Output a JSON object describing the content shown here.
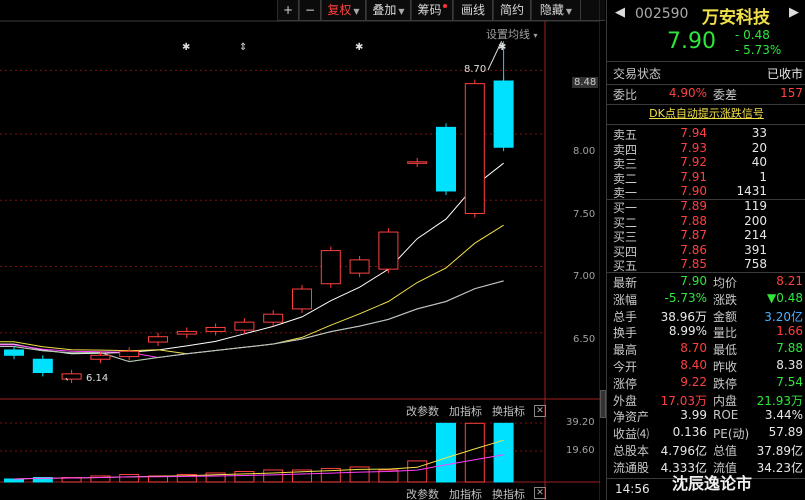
{
  "toolbar": [
    {
      "label": "+",
      "w": 22
    },
    {
      "label": "−",
      "w": 22
    },
    {
      "label": "复权",
      "w": 45,
      "active": true,
      "arrow": true
    },
    {
      "label": "叠加",
      "w": 45,
      "arrow": true
    },
    {
      "label": "筹码",
      "w": 42,
      "dot": true
    },
    {
      "label": "画线",
      "w": 40
    },
    {
      "label": "简约",
      "w": 38
    },
    {
      "label": "隐藏",
      "w": 50,
      "arrow": true
    }
  ],
  "chart": {
    "ma_setting": "设置均线",
    "max_label": "8.70",
    "min_label": "6.14",
    "price_ticks": [
      "8.48",
      "8.00",
      "7.50",
      "7.00",
      "6.50"
    ],
    "volume_ticks": [
      "39.20",
      "19.60"
    ],
    "indicator_buttons_top": [
      "改参数",
      "加指标",
      "换指标"
    ],
    "indicator_buttons_bottom": [
      "改参数",
      "加指标",
      "换指标"
    ],
    "star": "✱",
    "updown": "⇕",
    "close": "✕"
  },
  "chart_data": {
    "type": "candlestick",
    "ylim": [
      6.0,
      8.8
    ],
    "candles": [
      {
        "o": 6.37,
        "c": 6.33
      },
      {
        "o": 6.3,
        "c": 6.2
      },
      {
        "o": 6.15,
        "c": 6.19
      },
      {
        "o": 6.3,
        "c": 6.33
      },
      {
        "o": 6.32,
        "c": 6.36
      },
      {
        "o": 6.43,
        "c": 6.47
      },
      {
        "o": 6.49,
        "c": 6.51
      },
      {
        "o": 6.51,
        "c": 6.54
      },
      {
        "o": 6.52,
        "c": 6.58
      },
      {
        "o": 6.58,
        "c": 6.64
      },
      {
        "o": 6.68,
        "c": 6.83
      },
      {
        "o": 6.87,
        "c": 7.12
      },
      {
        "o": 6.95,
        "c": 7.05
      },
      {
        "o": 6.98,
        "c": 7.26
      },
      {
        "o": 7.78,
        "c": 7.79
      },
      {
        "o": 8.05,
        "c": 7.57
      },
      {
        "o": 7.4,
        "c": 8.38
      },
      {
        "o": 8.4,
        "c": 7.9
      }
    ],
    "volumes": [
      2,
      3,
      3,
      4,
      5,
      4,
      5,
      6,
      7,
      8,
      8,
      9,
      10,
      8,
      14,
      39,
      39,
      39
    ]
  },
  "quote": {
    "code": "002590",
    "name": "万安科技",
    "price": "7.90",
    "change": "- 0.48",
    "change_pct": "- 5.73%",
    "status_label": "交易状态",
    "status_value": "已收市",
    "wb_label": "委比",
    "wb_value": "4.90%",
    "wc_label": "委差",
    "wc_value": "157",
    "dk_signal": "DK点自动提示涨跌信号",
    "sell": [
      {
        "label": "卖五",
        "price": "7.94",
        "vol": "33"
      },
      {
        "label": "卖四",
        "price": "7.93",
        "vol": "20"
      },
      {
        "label": "卖三",
        "price": "7.92",
        "vol": "40"
      },
      {
        "label": "卖二",
        "price": "7.91",
        "vol": "1"
      },
      {
        "label": "卖一",
        "price": "7.90",
        "vol": "1431"
      }
    ],
    "buy": [
      {
        "label": "买一",
        "price": "7.89",
        "vol": "119"
      },
      {
        "label": "买二",
        "price": "7.88",
        "vol": "200"
      },
      {
        "label": "买三",
        "price": "7.87",
        "vol": "214"
      },
      {
        "label": "买四",
        "price": "7.86",
        "vol": "391"
      },
      {
        "label": "买五",
        "price": "7.85",
        "vol": "758"
      }
    ],
    "stats": [
      {
        "l1": "最新",
        "v1": "7.90",
        "c1": "green",
        "l2": "均价",
        "v2": "8.21",
        "c2": "red"
      },
      {
        "l1": "涨幅",
        "v1": "-5.73%",
        "c1": "green",
        "l2": "涨跌",
        "v2": "▼0.48",
        "c2": "green"
      },
      {
        "l1": "总手",
        "v1": "38.96万",
        "c1": "white",
        "l2": "金额",
        "v2": "3.20亿",
        "c2": "blue"
      },
      {
        "l1": "换手",
        "v1": "8.99%",
        "c1": "white",
        "l2": "量比",
        "v2": "1.66",
        "c2": "red"
      },
      {
        "l1": "最高",
        "v1": "8.70",
        "c1": "red",
        "l2": "最低",
        "v2": "7.88",
        "c2": "green"
      },
      {
        "l1": "今开",
        "v1": "8.40",
        "c1": "red",
        "l2": "昨收",
        "v2": "8.38",
        "c2": "white"
      },
      {
        "l1": "涨停",
        "v1": "9.22",
        "c1": "red",
        "l2": "跌停",
        "v2": "7.54",
        "c2": "green"
      },
      {
        "l1": "外盘",
        "v1": "17.03万",
        "c1": "red",
        "l2": "内盘",
        "v2": "21.93万",
        "c2": "green"
      },
      {
        "l1": "净资产",
        "v1": "3.99",
        "c1": "white",
        "l2": "ROE",
        "v2": "3.44%",
        "c2": "white"
      },
      {
        "l1": "收益⑷",
        "v1": "0.136",
        "c1": "white",
        "l2": "PE(动)",
        "v2": "57.89",
        "c2": "white"
      },
      {
        "l1": "总股本",
        "v1": "4.796亿",
        "c1": "white",
        "l2": "总值",
        "v2": "37.89亿",
        "c2": "white"
      },
      {
        "l1": "流通股",
        "v1": "4.333亿",
        "c1": "white",
        "l2": "流值",
        "v2": "34.23亿",
        "c2": "white"
      }
    ],
    "time": "14:56",
    "watermark": "沈辰逸论市"
  }
}
